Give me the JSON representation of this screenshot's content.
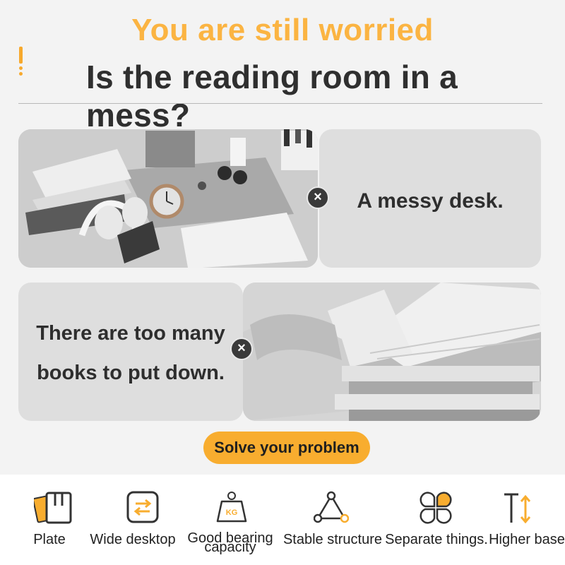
{
  "header": {
    "headline_top": "You are still worried",
    "headline_main": "Is the reading room in a mess?"
  },
  "problems": [
    {
      "caption": "A messy desk.",
      "close_icon": "close-icon"
    },
    {
      "caption_line1": "There are too many",
      "caption_line2": "books to put down.",
      "close_icon": "close-icon"
    }
  ],
  "cta": {
    "label": "Solve your problem"
  },
  "features": [
    {
      "label": "Plate",
      "icon": "plate-icon"
    },
    {
      "label": "Wide desktop",
      "icon": "wide-desktop-icon"
    },
    {
      "label": "Good bearing capacity",
      "icon": "kg-weight-icon",
      "icon_text": "KG"
    },
    {
      "label": "Stable structure",
      "icon": "triangle-structure-icon"
    },
    {
      "label": "Separate things.",
      "icon": "separate-leaves-icon"
    },
    {
      "label": "Higher base",
      "icon": "height-icon"
    }
  ],
  "colors": {
    "accent": "#f8ad2f",
    "headline_accent": "#fbb442",
    "text_dark": "#2f2f2f"
  }
}
